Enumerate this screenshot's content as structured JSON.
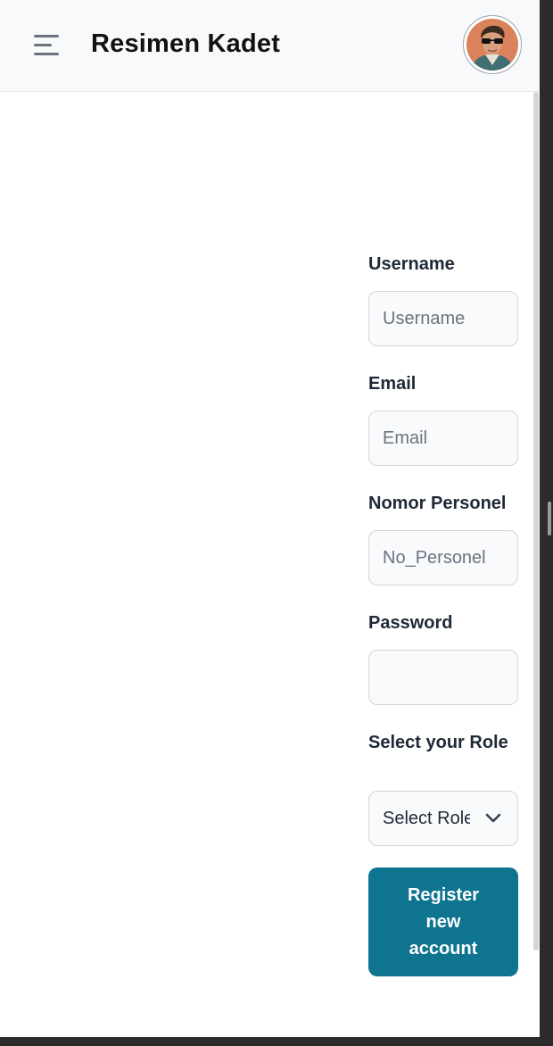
{
  "header": {
    "brand": "Resimen Kadet",
    "menu_icon": "hamburger-menu-icon",
    "avatar_icon": "user-avatar-icon"
  },
  "form": {
    "username": {
      "label": "Username",
      "placeholder": "Username",
      "value": ""
    },
    "email": {
      "label": "Email",
      "placeholder": "Email",
      "value": ""
    },
    "personnel": {
      "label": "Nomor Personel",
      "placeholder": "No_Personel",
      "value": ""
    },
    "password": {
      "label": "Password",
      "placeholder": "",
      "value": ""
    },
    "role": {
      "label": "Select your Role",
      "selected": "Select Role"
    },
    "submit_label": "Register new account"
  },
  "colors": {
    "accent": "#0e7490",
    "header_bg": "#f8f9fb",
    "field_bg": "#f9fafb",
    "field_border": "#d1d5db"
  }
}
